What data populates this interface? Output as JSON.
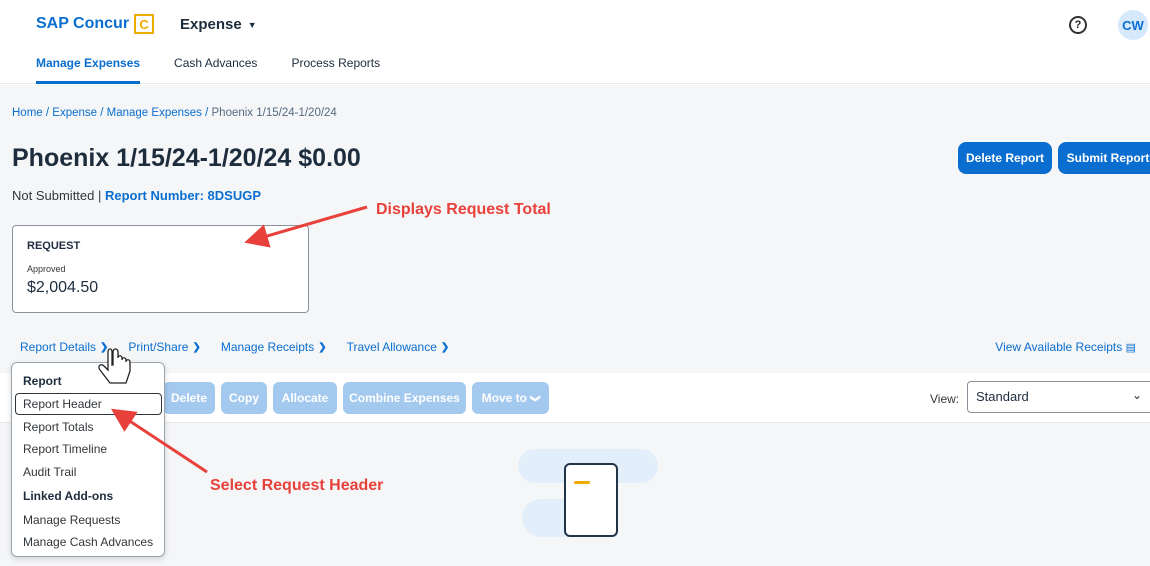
{
  "header": {
    "brand": "SAP Concur",
    "brand_logo_letter": "C",
    "product_menu": "Expense",
    "help_icon": "help-circle-icon",
    "avatar_initials": "CW",
    "tabs": [
      {
        "label": "Manage Expenses",
        "active": true
      },
      {
        "label": "Cash Advances",
        "active": false
      },
      {
        "label": "Process Reports",
        "active": false
      }
    ]
  },
  "breadcrumb": {
    "items": [
      "Home",
      "Expense",
      "Manage Expenses"
    ],
    "current": "Phoenix 1/15/24-1/20/24",
    "separator": " / "
  },
  "report": {
    "title": "Phoenix 1/15/24-1/20/24 $0.00",
    "status": "Not Submitted |",
    "report_number_label": "Report Number: 8DSUGP"
  },
  "buttons": {
    "delete_report": "Delete Report",
    "submit_report": "Submit Report"
  },
  "request_card": {
    "label": "REQUEST",
    "status": "Approved",
    "amount": "$2,004.50"
  },
  "actions": {
    "report_details": "Report Details",
    "print_share": "Print/Share",
    "manage_receipts": "Manage Receipts",
    "travel_allowance": "Travel Allowance",
    "view_available_receipts": "View Available Receipts"
  },
  "toolbar": {
    "delete": "Delete",
    "copy": "Copy",
    "allocate": "Allocate",
    "combine_expenses": "Combine Expenses",
    "move_to": "Move to",
    "view_label": "View:",
    "view_value": "Standard"
  },
  "dropdown": {
    "group_report": "Report",
    "report_header": "Report Header",
    "report_totals": "Report Totals",
    "report_timeline": "Report Timeline",
    "audit_trail": "Audit Trail",
    "group_linked": "Linked Add-ons",
    "manage_requests": "Manage Requests",
    "manage_cash_advances": "Manage Cash Advances"
  },
  "annotations": {
    "displays_request_total": "Displays Request Total",
    "select_request_header": "Select Request Header"
  },
  "colors": {
    "accent": "#0a6ed1",
    "disabled_button": "#a4c9ef",
    "annotation": "#e8413b",
    "brand_logo": "#f0ab00"
  }
}
